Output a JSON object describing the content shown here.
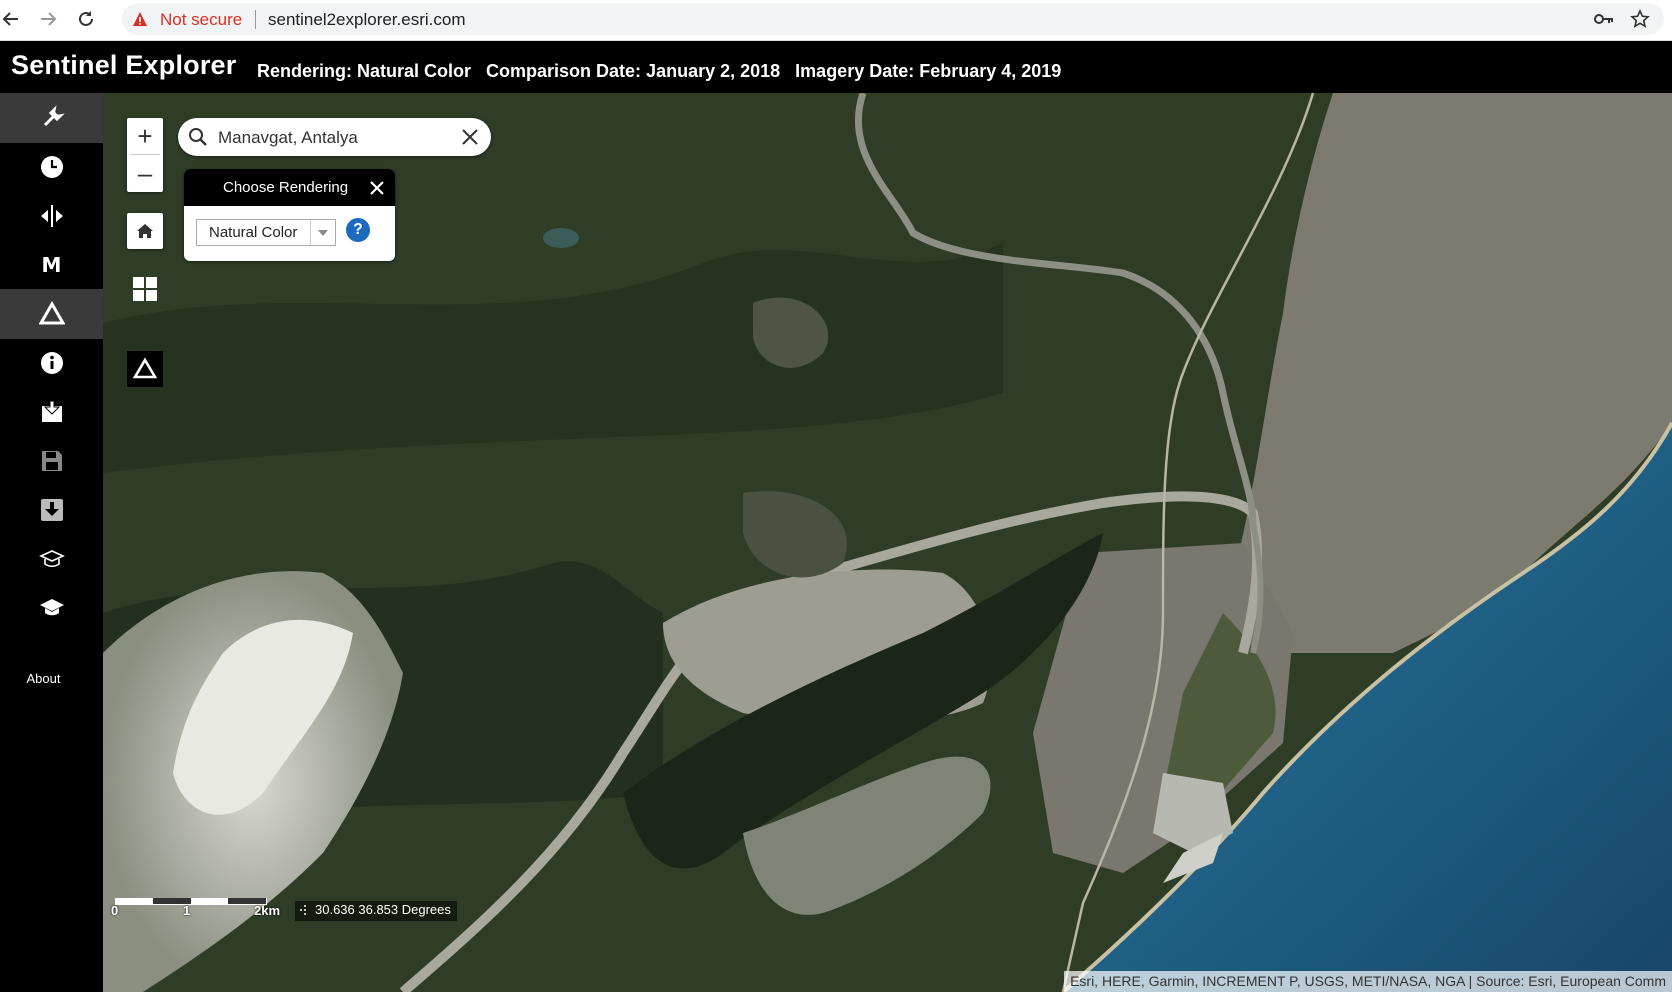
{
  "browser": {
    "security_label": "Not secure",
    "url": "sentinel2explorer.esri.com"
  },
  "header": {
    "title": "Sentinel Explorer",
    "rendering": "Rendering: Natural Color",
    "comparison_date": "Comparison Date: January 2, 2018",
    "imagery_date": "Imagery Date: February 4, 2019"
  },
  "sidebar": {
    "items": [
      {
        "name": "tools-icon",
        "active": true
      },
      {
        "name": "clock-icon",
        "active": false
      },
      {
        "name": "swipe-icon",
        "active": false
      },
      {
        "name": "m-icon",
        "letter": "M",
        "active": false
      },
      {
        "name": "triangle-icon",
        "active": true
      },
      {
        "name": "info-icon",
        "active": false
      },
      {
        "name": "bookmark-icon",
        "active": false
      },
      {
        "name": "save-icon",
        "active": false
      },
      {
        "name": "download-icon",
        "active": false
      },
      {
        "name": "story-icon",
        "active": false
      },
      {
        "name": "learn-icon",
        "active": false
      }
    ],
    "about_label": "About"
  },
  "map": {
    "search": {
      "value": "Manavgat, Antalya"
    },
    "zoom": {
      "in_label": "+",
      "out_label": "–"
    },
    "rendering_panel": {
      "title": "Choose Rendering",
      "selected": "Natural Color",
      "help_label": "?"
    },
    "scale": {
      "labels": [
        "0",
        "1",
        "2km"
      ]
    },
    "coordinates": "30.636 36.853 Degrees",
    "attribution": "Esri, HERE, Garmin, INCREMENT P, USGS, METI/NASA, NGA | Source: Esri, European Comm"
  },
  "colors": {
    "accent_help": "#1d6bbf",
    "not_secure": "#d93025",
    "sea": "#1e5a80",
    "forest": "#2f3d27"
  }
}
